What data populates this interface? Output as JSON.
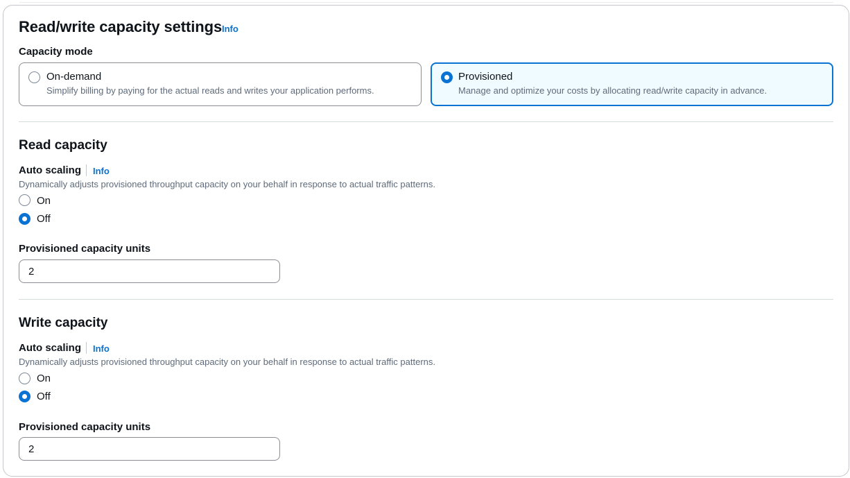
{
  "header": {
    "title": "Read/write capacity settings",
    "info": "Info"
  },
  "capacity_mode": {
    "label": "Capacity mode",
    "options": [
      {
        "title": "On-demand",
        "description": "Simplify billing by paying for the actual reads and writes your application performs.",
        "selected": false
      },
      {
        "title": "Provisioned",
        "description": "Manage and optimize your costs by allocating read/write capacity in advance.",
        "selected": true
      }
    ]
  },
  "read": {
    "title": "Read capacity",
    "auto_scaling": {
      "label": "Auto scaling",
      "info": "Info",
      "description": "Dynamically adjusts provisioned throughput capacity on your behalf in response to actual traffic patterns.",
      "options": [
        {
          "label": "On",
          "checked": false
        },
        {
          "label": "Off",
          "checked": true
        }
      ]
    },
    "units": {
      "label": "Provisioned capacity units",
      "value": "2"
    }
  },
  "write": {
    "title": "Write capacity",
    "auto_scaling": {
      "label": "Auto scaling",
      "info": "Info",
      "description": "Dynamically adjusts provisioned throughput capacity on your behalf in response to actual traffic patterns.",
      "options": [
        {
          "label": "On",
          "checked": false
        },
        {
          "label": "Off",
          "checked": true
        }
      ]
    },
    "units": {
      "label": "Provisioned capacity units",
      "value": "2"
    }
  },
  "colors": {
    "accent": "#0972d3",
    "selected_tile_bg": "#f0fbff",
    "text": "#0f141a",
    "secondary_text": "#5f6b7a"
  }
}
